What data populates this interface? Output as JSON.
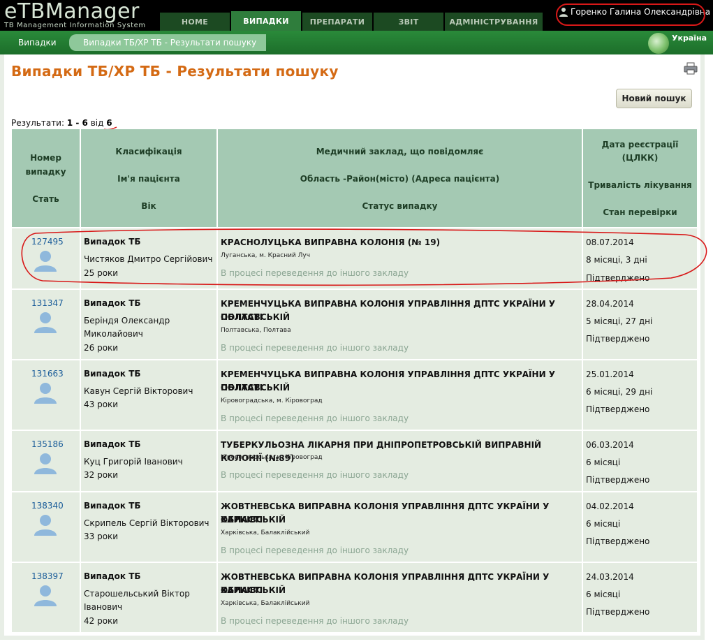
{
  "app": {
    "logo_main": "eTBManager",
    "logo_sub": "TB Management Information System",
    "user": "Горенко Галина Олександрівна",
    "country": "Україна"
  },
  "nav": {
    "tabs": [
      {
        "label": "HOME",
        "active": false
      },
      {
        "label": "ВИПАДКИ",
        "active": true
      },
      {
        "label": "ПРЕПАРАТИ",
        "active": false
      },
      {
        "label": "ЗВІТ",
        "active": false
      },
      {
        "label": "АДМІНІСТРУВАННЯ",
        "active": false
      }
    ]
  },
  "breadcrumb": {
    "root": "Випадки",
    "current": "Випадки ТБ/ХР ТБ - Результати пошуку"
  },
  "page": {
    "title": "Випадки ТБ/ХР ТБ - Результати пошуку",
    "new_search": "Новий пошук",
    "results_label": "Результати:",
    "results_range": "1 - 6",
    "results_of": "від",
    "results_total": "6"
  },
  "table": {
    "headers": {
      "col1": [
        "Номер",
        "випадку",
        "Стать"
      ],
      "col2": [
        "Класифікація",
        "Ім'я пацієнта",
        "Вік"
      ],
      "col3": [
        "Медичний заклад, що повідомляє",
        "Область -Район(місто) (Адреса пацієнта)",
        "Статус випадку"
      ],
      "col4": [
        "Дата реєстрації",
        "(ЦЛКК)",
        "Тривалість лікування",
        "Стан перевірки"
      ]
    },
    "rows": [
      {
        "number": "127495",
        "classification": "Випадок ТБ",
        "name_line1": "Чистяков Дмитро Сергійович",
        "name_line2": "",
        "age": "25 роки",
        "unit_line1": "КРАСНОЛУЦЬКА ВИПРАВНА КОЛОНІЯ (№ 19)",
        "unit_line2": "",
        "address": "Луганська, м. Красний Луч",
        "status": "В процесі переведення до іншого закладу",
        "date": "08.07.2014",
        "duration": "8 місяці, 3 дні",
        "verification": "Підтверджено"
      },
      {
        "number": "131347",
        "classification": "Випадок ТБ",
        "name_line1": "Беріндя Олександр",
        "name_line2": "Миколайович",
        "age": "26 роки",
        "unit_line1": "КРЕМЕНЧУЦЬКА ВИПРАВНА КОЛОНІЯ УПРАВЛІННЯ ДПТС УКРАЇНИ У ПОЛТАВСЬКІЙ",
        "unit_line2": "ОБЛАСТІ",
        "address": "Полтавська, Полтава",
        "status": "В процесі переведення до іншого закладу",
        "date": "28.04.2014",
        "duration": "5 місяці, 27 дні",
        "verification": "Підтверджено"
      },
      {
        "number": "131663",
        "classification": "Випадок ТБ",
        "name_line1": "Кавун Сергій Вікторович",
        "name_line2": "",
        "age": "43 роки",
        "unit_line1": "КРЕМЕНЧУЦЬКА ВИПРАВНА КОЛОНІЯ УПРАВЛІННЯ ДПТС УКРАЇНИ У ПОЛТАВСЬКІЙ",
        "unit_line2": "ОБЛАСТІ",
        "address": "Кіровоградська, м. Кіровоград",
        "status": "В процесі переведення до іншого закладу",
        "date": "25.01.2014",
        "duration": "6 місяці, 29 дні",
        "verification": "Підтверджено"
      },
      {
        "number": "135186",
        "classification": "Випадок ТБ",
        "name_line1": "Куц Григорій Іванович",
        "name_line2": "",
        "age": "32 роки",
        "unit_line1": "ТУБЕРКУЛЬОЗНА ЛІКАРНЯ ПРИ ДНІПРОПЕТРОВСЬКІЙ ВИПРАВНІЙ КОЛОНІЇ (№89)",
        "unit_line2": "",
        "address": "Кіровоградська, м. Кіровоград",
        "status": "В процесі переведення до іншого закладу",
        "date": "06.03.2014",
        "duration": "6 місяці",
        "verification": "Підтверджено"
      },
      {
        "number": "138340",
        "classification": "Випадок ТБ",
        "name_line1": "Скрипель Сергій Вікторович",
        "name_line2": "",
        "age": "33 роки",
        "unit_line1": "ЖОВТНЕВСЬКА ВИПРАВНА КОЛОНІЯ УПРАВЛІННЯ ДПТС УКРАЇНИ У ХАРКІВСЬКІЙ",
        "unit_line2": "ОБЛАСТІ",
        "address": "Харківська, Балаклійський",
        "status": "В процесі переведення до іншого закладу",
        "date": "04.02.2014",
        "duration": "6 місяці",
        "verification": "Підтверджено"
      },
      {
        "number": "138397",
        "classification": "Випадок ТБ",
        "name_line1": "Старошельський Віктор",
        "name_line2": "Іванович",
        "age": "42 роки",
        "unit_line1": "ЖОВТНЕВСЬКА ВИПРАВНА КОЛОНІЯ УПРАВЛІННЯ ДПТС УКРАЇНИ У ХАРКІВСЬКІЙ",
        "unit_line2": "ОБЛАСТІ",
        "address": "Харківська, Балаклійський",
        "status": "В процесі переведення до іншого закладу",
        "date": "24.03.2014",
        "duration": "6 місяці",
        "verification": "Підтверджено"
      }
    ]
  },
  "icons": {
    "user": "user-icon",
    "avatar": "person-avatar-icon",
    "print": "printer-icon",
    "globe": "globe-icon"
  },
  "colors": {
    "accent": "#d46a14",
    "header_bg": "#a4c9b3",
    "row_bg": "#e4ece1",
    "link": "#1a5c99",
    "annotation": "#d81818"
  }
}
